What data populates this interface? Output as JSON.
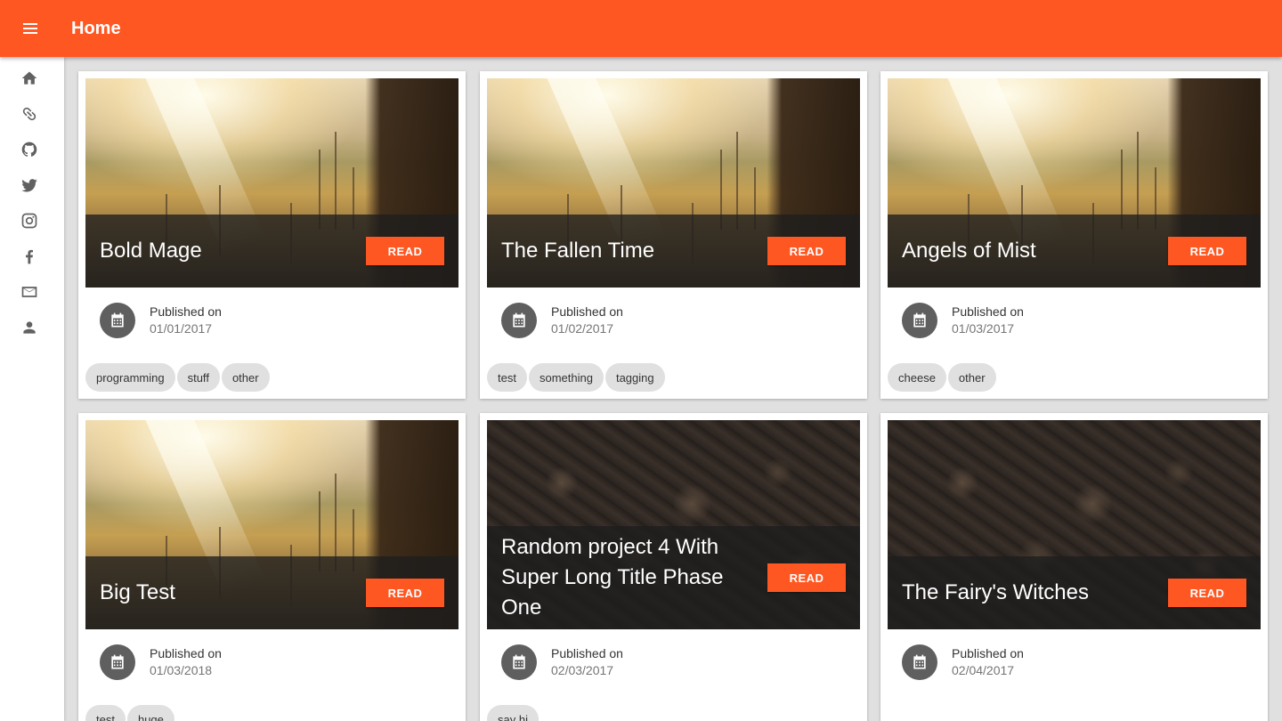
{
  "header": {
    "title": "Home",
    "menu_icon": "menu-icon",
    "color": "#ff5722"
  },
  "sidebar": {
    "items": [
      {
        "name": "home",
        "icon": "home-icon"
      },
      {
        "name": "link",
        "icon": "link-icon"
      },
      {
        "name": "github",
        "icon": "github-icon"
      },
      {
        "name": "twitter",
        "icon": "twitter-icon"
      },
      {
        "name": "instagram",
        "icon": "instagram-icon"
      },
      {
        "name": "facebook",
        "icon": "facebook-icon"
      },
      {
        "name": "email",
        "icon": "envelope-icon"
      },
      {
        "name": "profile",
        "icon": "person-icon"
      }
    ]
  },
  "cards": [
    {
      "title": "Bold Mage",
      "read_label": "READ",
      "published_label": "Published on",
      "date": "01/01/2017",
      "image": "sunlit-meadow",
      "tags": [
        "programming",
        "stuff",
        "other"
      ]
    },
    {
      "title": "The Fallen Time",
      "read_label": "READ",
      "published_label": "Published on",
      "date": "01/02/2017",
      "image": "sunlit-meadow",
      "tags": [
        "test",
        "something",
        "tagging"
      ]
    },
    {
      "title": "Angels of Mist",
      "read_label": "READ",
      "published_label": "Published on",
      "date": "01/03/2017",
      "image": "sunlit-meadow",
      "tags": [
        "cheese",
        "other"
      ]
    },
    {
      "title": "Big Test",
      "read_label": "READ",
      "published_label": "Published on",
      "date": "01/03/2018",
      "image": "sunlit-meadow",
      "tags": [
        "test",
        "huge"
      ]
    },
    {
      "title": "Random project 4 With Super Long Title Phase One",
      "read_label": "READ",
      "published_label": "Published on",
      "date": "02/03/2017",
      "image": "dark-pebbles",
      "tags": [
        "say hi"
      ]
    },
    {
      "title": "The Fairy's Witches",
      "read_label": "READ",
      "published_label": "Published on",
      "date": "02/04/2017",
      "image": "dark-pebbles",
      "tags": []
    }
  ],
  "colors": {
    "accent": "#ff5722",
    "background": "#e0e0e0",
    "card": "#ffffff",
    "chip": "#e0e0e0"
  }
}
